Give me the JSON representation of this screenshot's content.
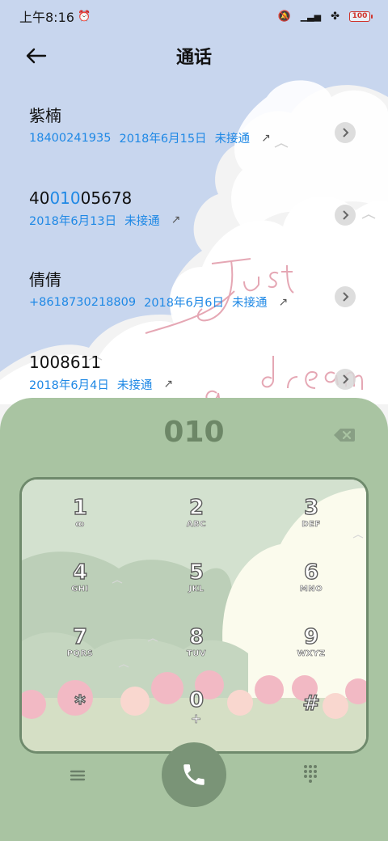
{
  "status_bar": {
    "time": "上午8:16",
    "battery": "100",
    "icons": [
      "alarm-icon",
      "mute-icon",
      "signal-icon",
      "wifi-icon",
      "battery-icon"
    ]
  },
  "header": {
    "title": "通话",
    "back_icon": "arrow-left-icon"
  },
  "calls": [
    {
      "name": "紫楠",
      "number": "18400241935",
      "date": "2018年6月15日",
      "status": "未接通"
    },
    {
      "name_prefix": "40",
      "name_highlight": "010",
      "name_suffix": "05678",
      "date": "2018年6月13日",
      "status": "未接通"
    },
    {
      "name": "倩倩",
      "number": "+8618730218809",
      "date": "2018年6月6日",
      "status": "未接通"
    },
    {
      "name": "1008611",
      "date": "2018年6月4日",
      "status": "未接通"
    }
  ],
  "wallpaper_text": [
    "Just",
    "a dream"
  ],
  "dialer": {
    "number": "010",
    "keys": [
      {
        "digit": "1",
        "letters": "ꝏ"
      },
      {
        "digit": "2",
        "letters": "ABC"
      },
      {
        "digit": "3",
        "letters": "DEF"
      },
      {
        "digit": "4",
        "letters": "GHI"
      },
      {
        "digit": "5",
        "letters": "JKL"
      },
      {
        "digit": "6",
        "letters": "MNO"
      },
      {
        "digit": "7",
        "letters": "PQRS"
      },
      {
        "digit": "8",
        "letters": "TUV"
      },
      {
        "digit": "9",
        "letters": "WXYZ"
      },
      {
        "digit": "*",
        "letters": ""
      },
      {
        "digit": "0",
        "letters": "+"
      },
      {
        "digit": "#",
        "letters": ""
      }
    ]
  },
  "colors": {
    "accent_blue": "#1e88e5",
    "panel_green": "#a9c4a2",
    "call_button": "#7a9477"
  }
}
